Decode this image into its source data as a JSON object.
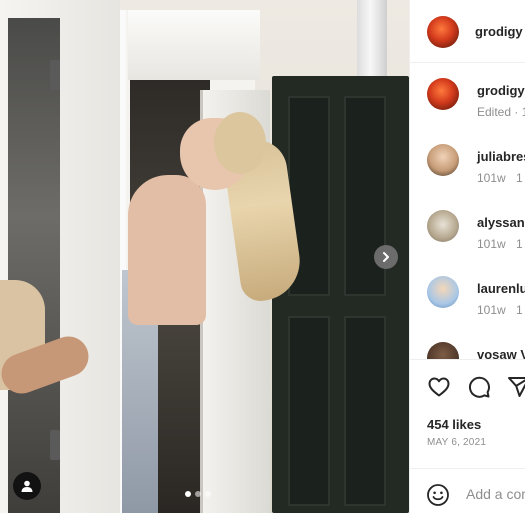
{
  "post": {
    "username": "grodigy",
    "next_icon": "chevron-right-icon",
    "tag_icon": "user-icon",
    "carousel_count": 3,
    "carousel_active_index": 0
  },
  "caption": {
    "username": "grodigy",
    "meta": "Edited · 1"
  },
  "comments": [
    {
      "username": "juliabres",
      "age": "101w",
      "likes": "1"
    },
    {
      "username": "alyssanic",
      "age": "101w",
      "likes": "1"
    },
    {
      "username": "laurenlu",
      "age": "101w",
      "likes": "1"
    },
    {
      "username": "vosaw V",
      "age": "",
      "likes": ""
    }
  ],
  "actions": {
    "like_icon": "heart-icon",
    "comment_icon": "comment-icon",
    "share_icon": "send-icon",
    "likes_text": "454 likes",
    "date_text": "MAY 6, 2021"
  },
  "composer": {
    "emoji_icon": "emoji-icon",
    "placeholder": "Add a comment..."
  }
}
